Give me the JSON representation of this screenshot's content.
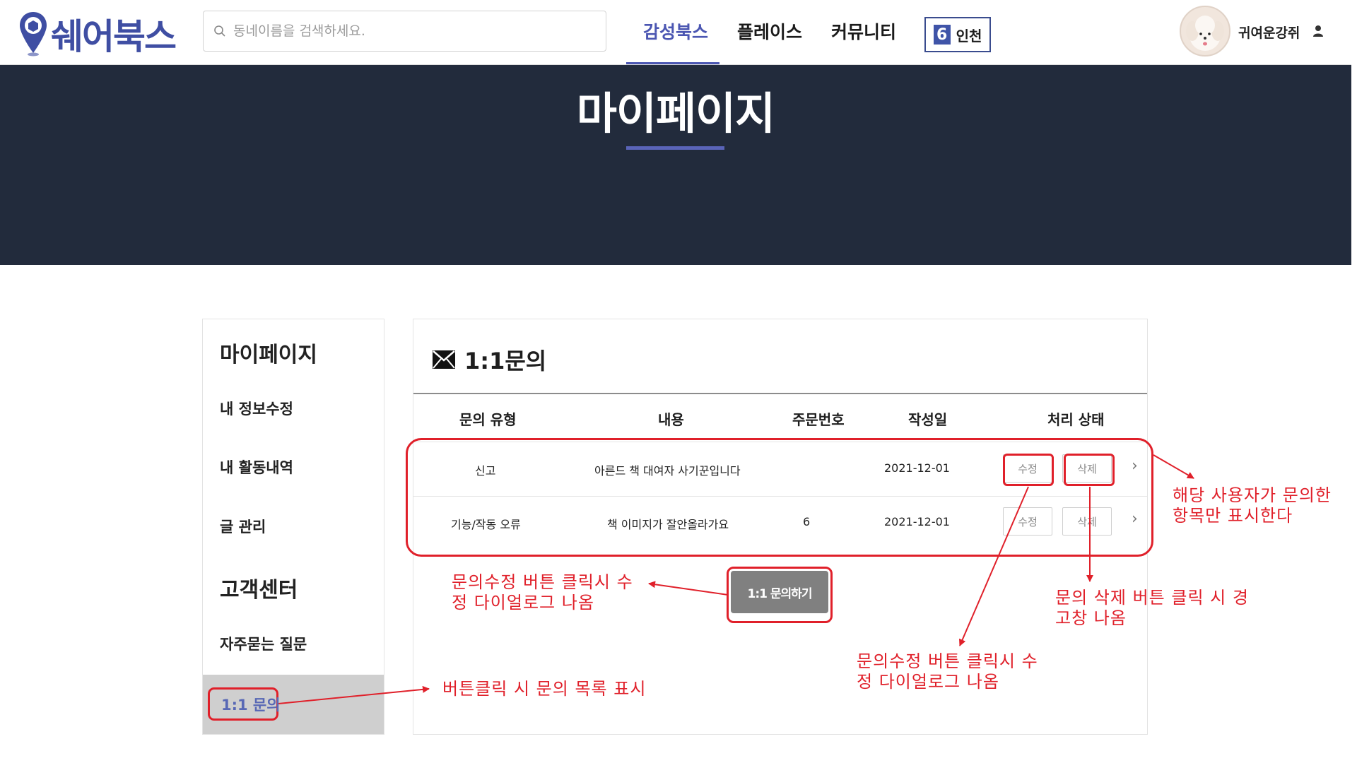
{
  "header": {
    "logo_text": "쉐어북스",
    "search_placeholder": "동네이름을 검색하세요.",
    "nav": [
      "감성북스",
      "플레이스",
      "커뮤니티"
    ],
    "region": {
      "badge": "6",
      "name": "인천"
    },
    "username": "귀여운강쥐"
  },
  "banner": {
    "title": "마이페이지"
  },
  "sidebar": {
    "heading_mypage": "마이페이지",
    "items_mypage": [
      "내 정보수정",
      "내 활동내역",
      "글 관리"
    ],
    "heading_support": "고객센터",
    "items_support": [
      "자주묻는 질문",
      "1:1 문의"
    ]
  },
  "panel": {
    "title": "1:1문의",
    "columns": [
      "문의 유형",
      "내용",
      "주문번호",
      "작성일",
      "처리 상태"
    ],
    "rows": [
      {
        "type": "신고",
        "content": "아른드 책 대여자 사기꾼입니다",
        "order_no": "",
        "date": "2021-12-01",
        "edit": "수정",
        "delete": "삭제"
      },
      {
        "type": "기능/작동 오류",
        "content": "책 이미지가 잘안올라가요",
        "order_no": "6",
        "date": "2021-12-01",
        "edit": "수정",
        "delete": "삭제"
      }
    ],
    "ask_button": "1:1 문의하기"
  },
  "annotations": {
    "rows_note": "해당 사용자가 문의한\n항목만 표시한다",
    "ask_note": "문의수정 버튼 클릭시 수\n정 다이얼로그 나옴",
    "delete_note": "문의 삭제 버튼 클릭 시 경\n고창 나옴",
    "edit_note": "문의수정 버튼 클릭시 수\n정 다이얼로그 나옴",
    "menu_note": "버튼클릭 시 문의 목록 표시"
  },
  "colors": {
    "brand": "#3f4ea3",
    "banner_bg": "#222b3c",
    "annotation": "#e0202a",
    "ask_button": "#808080",
    "active_menu_bg": "#cfcfcf"
  }
}
